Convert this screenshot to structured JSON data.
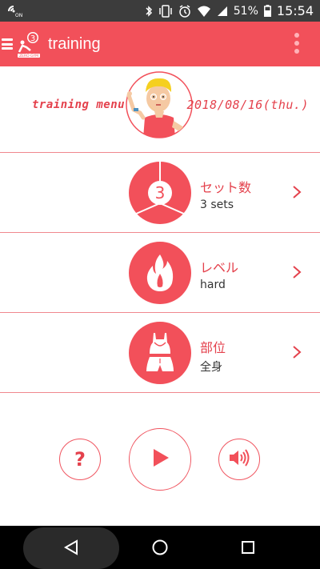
{
  "status_bar": {
    "battery_percent": "51%",
    "time": "15:54",
    "icons": [
      "nfc-icon",
      "bluetooth-icon",
      "vibrate-icon",
      "alarm-icon",
      "wifi-icon",
      "signal-icon",
      "battery-icon"
    ]
  },
  "app_bar": {
    "title": "training",
    "logo_text": "ZERO GYM",
    "logo_number": "3"
  },
  "header": {
    "menu_label": "training menu",
    "date": "2018/08/16(thu.)"
  },
  "rows": [
    {
      "label": "セット数",
      "value": "3 sets",
      "icon": "sets-3-icon",
      "icon_number": "3"
    },
    {
      "label": "レベル",
      "value": "hard",
      "icon": "flame-icon"
    },
    {
      "label": "部位",
      "value": "全身",
      "icon": "full-body-icon"
    }
  ],
  "controls": {
    "help_label": "?",
    "icons": [
      "help-icon",
      "play-icon",
      "volume-icon"
    ]
  },
  "colors": {
    "accent": "#f2505a",
    "accent_text": "#e4414c",
    "divider": "#f0888e",
    "status_bar": "#3c3c3c",
    "nav_bar": "#000000"
  }
}
